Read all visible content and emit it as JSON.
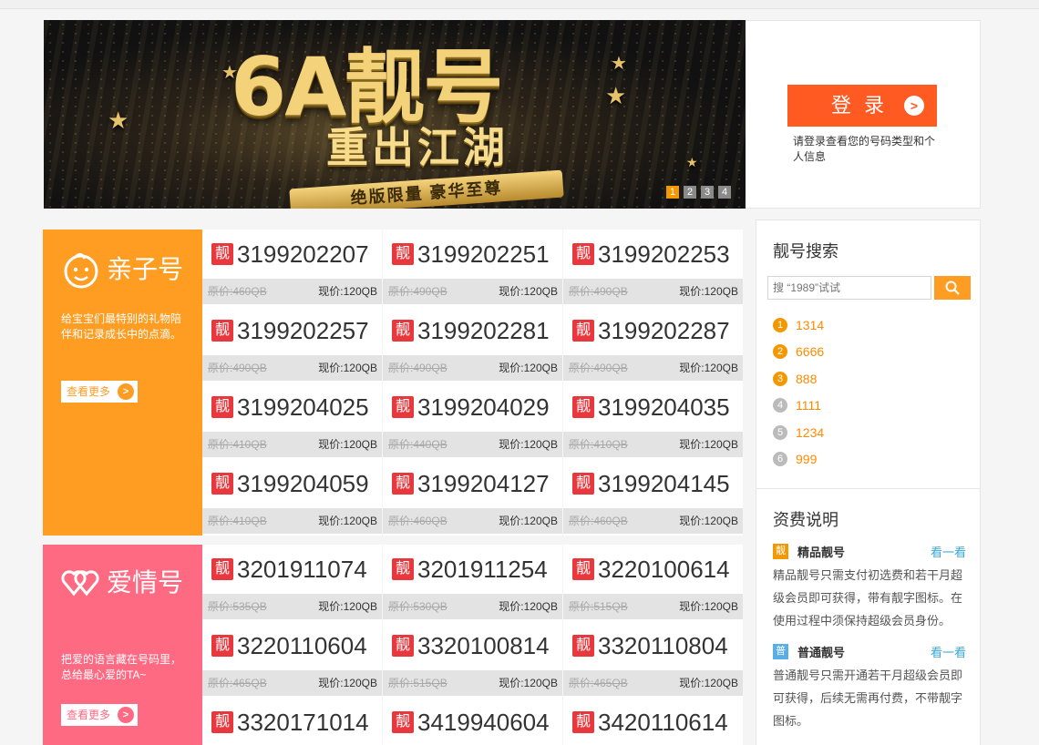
{
  "banner": {
    "line1": "6A靓号",
    "line2": "重出江湖",
    "ribbon": "绝版限量  豪华至尊",
    "pages": [
      "1",
      "2",
      "3",
      "4"
    ]
  },
  "login": {
    "button": "登录",
    "tip": "请登录查看您的号码类型和个人信息"
  },
  "categories": [
    {
      "name": "亲子号",
      "desc": "给宝宝们最特别的礼物陪伴和记录成长中的点滴。",
      "more": "查看更多"
    },
    {
      "name": "爱情号",
      "desc": "把爱的语言藏在号码里，总给最心爱的TA~",
      "more": "查看更多"
    }
  ],
  "badge": "靓",
  "numbers1": [
    {
      "num": "3199202207",
      "orig": "原价:460QB",
      "cur": "现价:120QB"
    },
    {
      "num": "3199202251",
      "orig": "原价:490QB",
      "cur": "现价:120QB"
    },
    {
      "num": "3199202253",
      "orig": "原价:490QB",
      "cur": "现价:120QB"
    },
    {
      "num": "3199202257",
      "orig": "原价:490QB",
      "cur": "现价:120QB"
    },
    {
      "num": "3199202281",
      "orig": "原价:490QB",
      "cur": "现价:120QB"
    },
    {
      "num": "3199202287",
      "orig": "原价:490QB",
      "cur": "现价:120QB"
    },
    {
      "num": "3199204025",
      "orig": "原价:410QB",
      "cur": "现价:120QB"
    },
    {
      "num": "3199204029",
      "orig": "原价:440QB",
      "cur": "现价:120QB"
    },
    {
      "num": "3199204035",
      "orig": "原价:410QB",
      "cur": "现价:120QB"
    },
    {
      "num": "3199204059",
      "orig": "原价:410QB",
      "cur": "现价:120QB"
    },
    {
      "num": "3199204127",
      "orig": "原价:460QB",
      "cur": "现价:120QB"
    },
    {
      "num": "3199204145",
      "orig": "原价:460QB",
      "cur": "现价:120QB"
    }
  ],
  "numbers2": [
    {
      "num": "3201911074",
      "orig": "原价:535QB",
      "cur": "现价:120QB"
    },
    {
      "num": "3201911254",
      "orig": "原价:530QB",
      "cur": "现价:120QB"
    },
    {
      "num": "3220100614",
      "orig": "原价:515QB",
      "cur": "现价:120QB"
    },
    {
      "num": "3220110604",
      "orig": "原价:465QB",
      "cur": "现价:120QB"
    },
    {
      "num": "3320100814",
      "orig": "原价:515QB",
      "cur": "现价:120QB"
    },
    {
      "num": "3320110804",
      "orig": "原价:465QB",
      "cur": "现价:120QB"
    },
    {
      "num": "3320171014",
      "orig": "",
      "cur": ""
    },
    {
      "num": "3419940604",
      "orig": "",
      "cur": ""
    },
    {
      "num": "3420110614",
      "orig": "",
      "cur": ""
    }
  ],
  "search": {
    "title": "靓号搜索",
    "placeholder": "搜 “1989”试试",
    "hot": [
      {
        "rank": "1",
        "value": "1314"
      },
      {
        "rank": "2",
        "value": "6666"
      },
      {
        "rank": "3",
        "value": "888"
      },
      {
        "rank": "4",
        "value": "1111"
      },
      {
        "rank": "5",
        "value": "1234"
      },
      {
        "rank": "6",
        "value": "999"
      }
    ]
  },
  "fees": {
    "title": "资费说明",
    "items": [
      {
        "icon": "靓",
        "name": "精品靓号",
        "look": "看一看",
        "text": "精品靓号只需支付初选费和若干月超级会员即可获得，带有靓字图标。在使用过程中须保持超级会员身份。"
      },
      {
        "icon": "普",
        "name": "普通靓号",
        "look": "看一看",
        "text": "普通靓号只需开通若干月超级会员即可获得，后续无需再付费，不带靓字图标。"
      }
    ]
  },
  "colors": {
    "accent_orange": "#ff9c22",
    "accent_pink": "#ff6a83",
    "login_red": "#ff5a22",
    "badge_red": "#e8383d"
  }
}
